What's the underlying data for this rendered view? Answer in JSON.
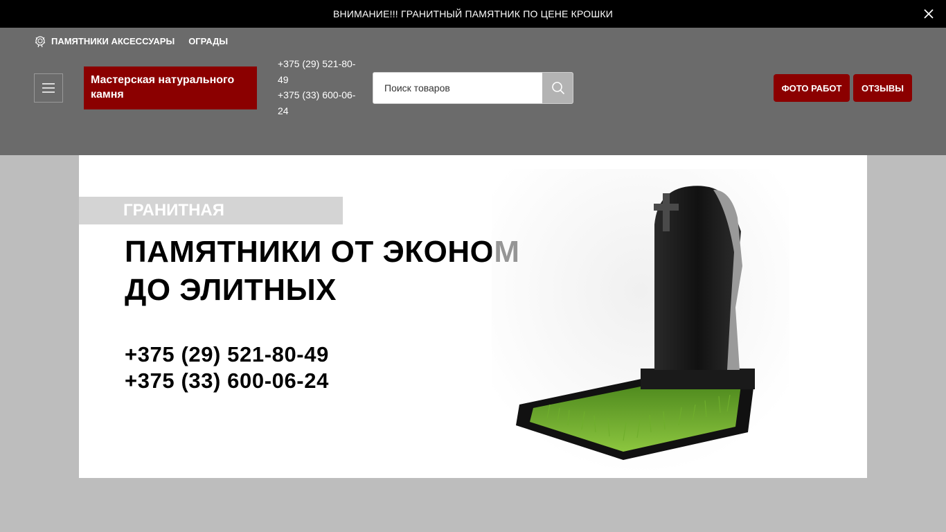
{
  "announcement": {
    "text": "ВНИМАНИЕ!!! ГРАНИТНЫЙ ПАМЯТНИК ПО ЦЕНЕ КРОШКИ",
    "close_icon": "close-icon"
  },
  "nav": {
    "items": [
      {
        "label": "ПАМЯТНИКИ АКСЕССУАРЫ",
        "icon": "wreath-icon"
      },
      {
        "label": "ОГРАДЫ"
      }
    ]
  },
  "header": {
    "menu_icon": "hamburger-icon",
    "logo_text": "Мастерская натурального камня",
    "phones": [
      "+375 (29) 521-80-49",
      "+375 (33) 600-06-24"
    ],
    "search": {
      "placeholder": "Поиск товаров",
      "value": "",
      "icon": "search-icon"
    },
    "buttons": {
      "photo_works": "ФОТО РАБОТ",
      "reviews": "ОТЗЫВЫ"
    }
  },
  "banner": {
    "tag": "ГРАНИТНАЯ МАСТЕРСКАЯ",
    "headline_line1": "ПАМЯТНИКИ ОТ ЭКОНОМ",
    "headline_line2": "ДО ЭЛИТНЫХ",
    "phone1": "+375 (29) 521-80-49",
    "phone2": "+375 (33) 600-06-24"
  },
  "colors": {
    "topbar_bg": "#000000",
    "header_bg": "#6b6b6b",
    "accent": "#8b0000",
    "page_bg": "#bdbdbd",
    "search_button_bg": "#b3b3b3"
  }
}
